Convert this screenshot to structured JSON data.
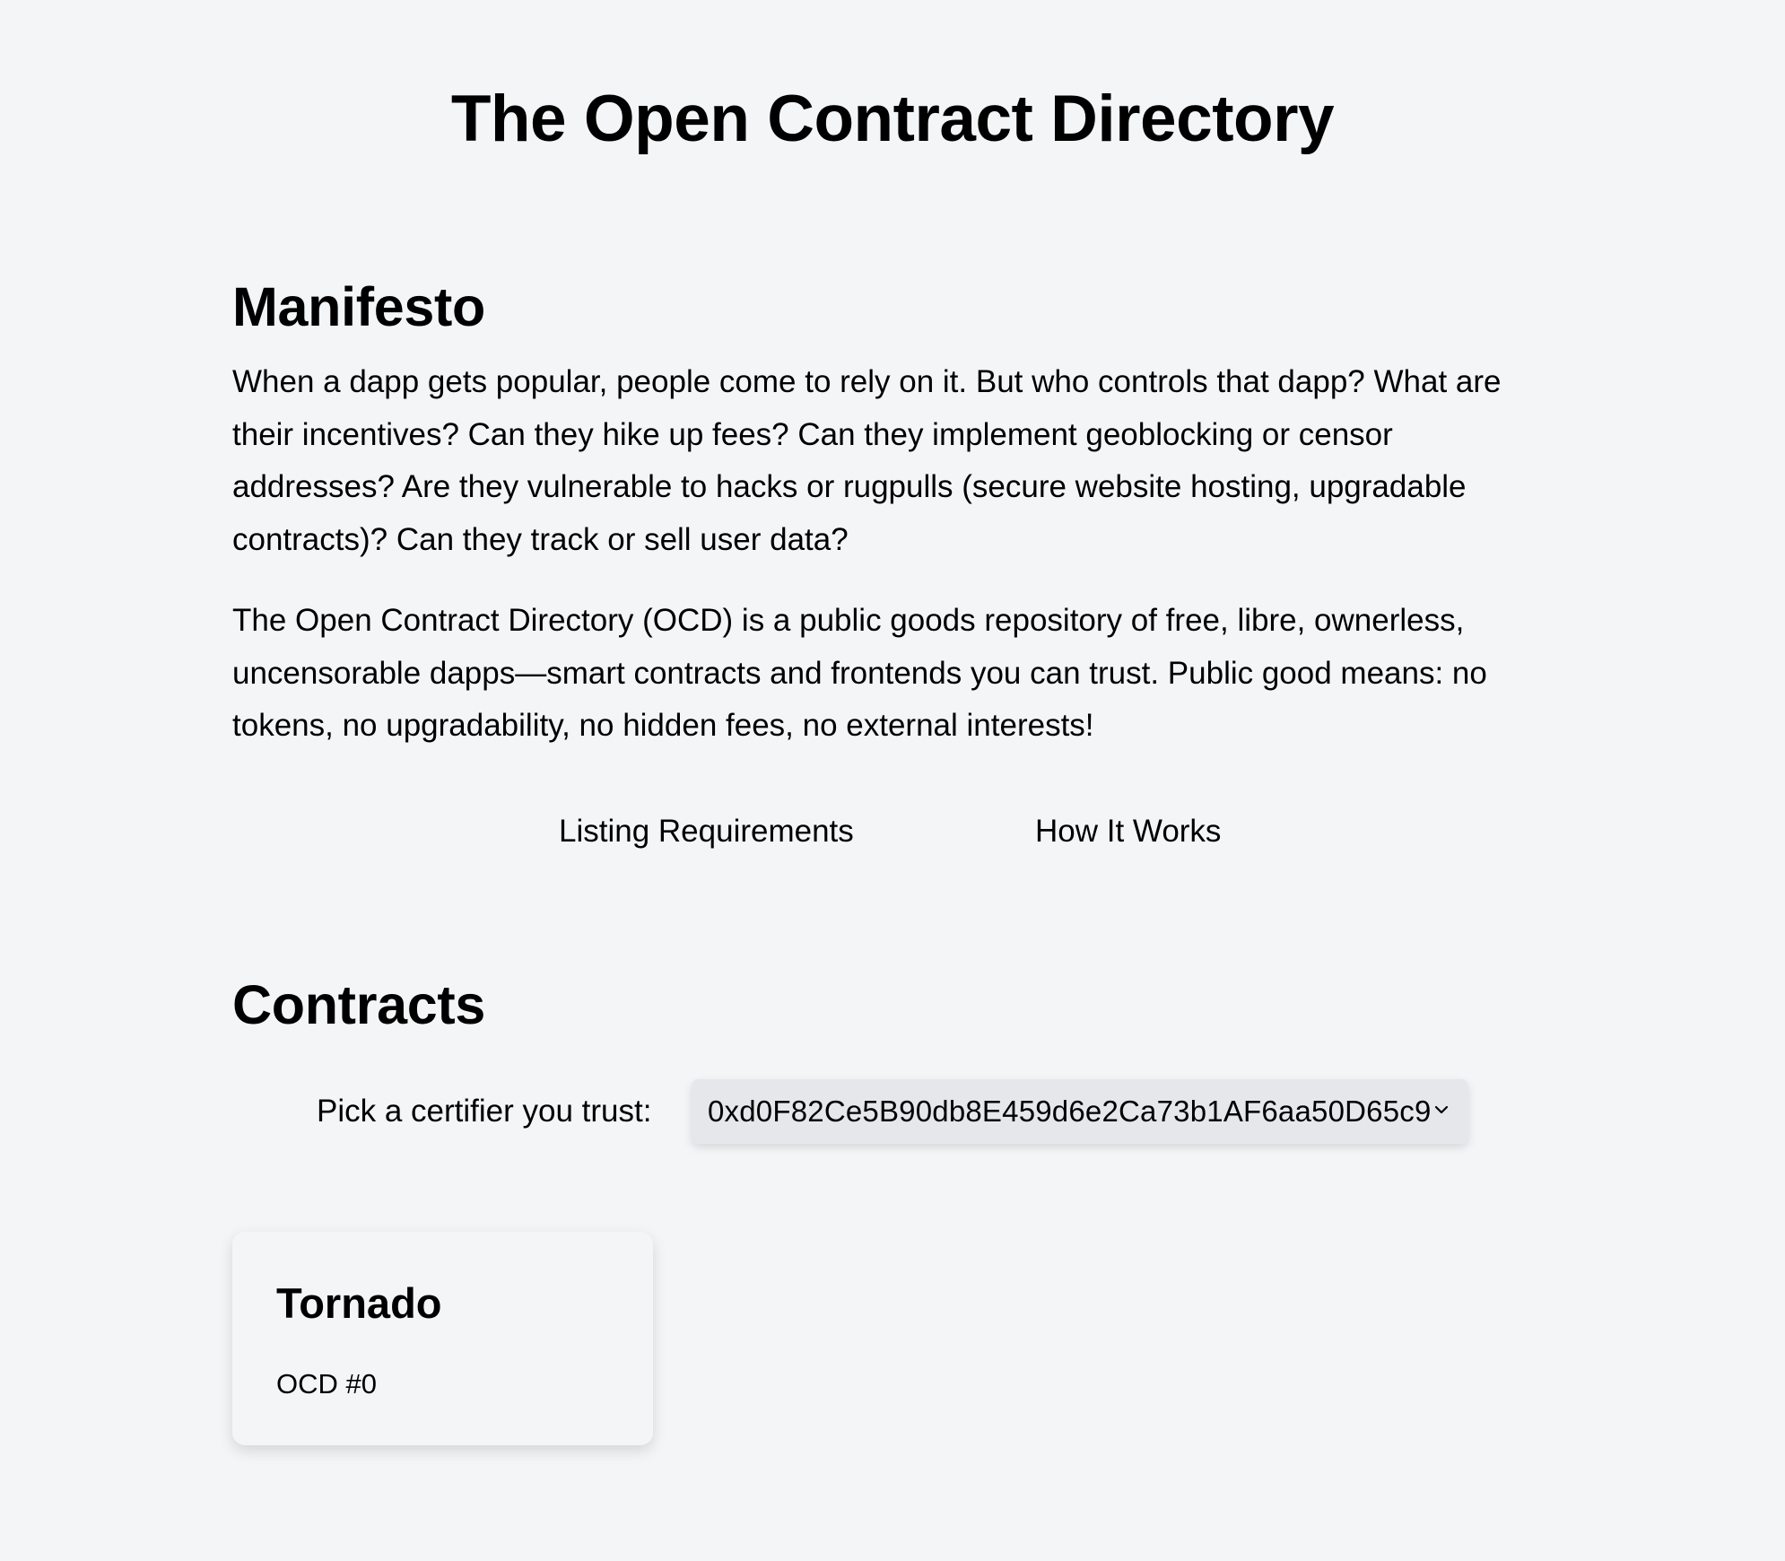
{
  "header": {
    "title": "The Open Contract Directory"
  },
  "manifesto": {
    "heading": "Manifesto",
    "paragraphs": [
      "When a dapp gets popular, people come to rely on it. But who controls that dapp? What are their incentives? Can they hike up fees? Can they implement geoblocking or censor addresses? Are they vulnerable to hacks or rugpulls (secure website hosting, upgradable contracts)? Can they track or sell user data?",
      "The Open Contract Directory (OCD) is a public goods repository of free, libre, ownerless, uncensorable dapps—smart contracts and frontends you can trust. Public good means: no tokens, no upgradability, no hidden fees, no external interests!"
    ]
  },
  "nav": {
    "listing_requirements": "Listing Requirements",
    "how_it_works": "How It Works"
  },
  "contracts": {
    "heading": "Contracts",
    "certifier_label": "Pick a certifier you trust:",
    "certifier_selected": "0xd0F82Ce5B90db8E459d6e2Ca73b1AF6aa50D65c9",
    "cards": [
      {
        "name": "Tornado",
        "id_label": "OCD #0"
      }
    ]
  },
  "icons": {
    "select_arrow": "chevron-down-icon"
  },
  "colors": {
    "background": "#f4f5f7",
    "select_background": "#e6e7eb",
    "text": "#000000"
  }
}
